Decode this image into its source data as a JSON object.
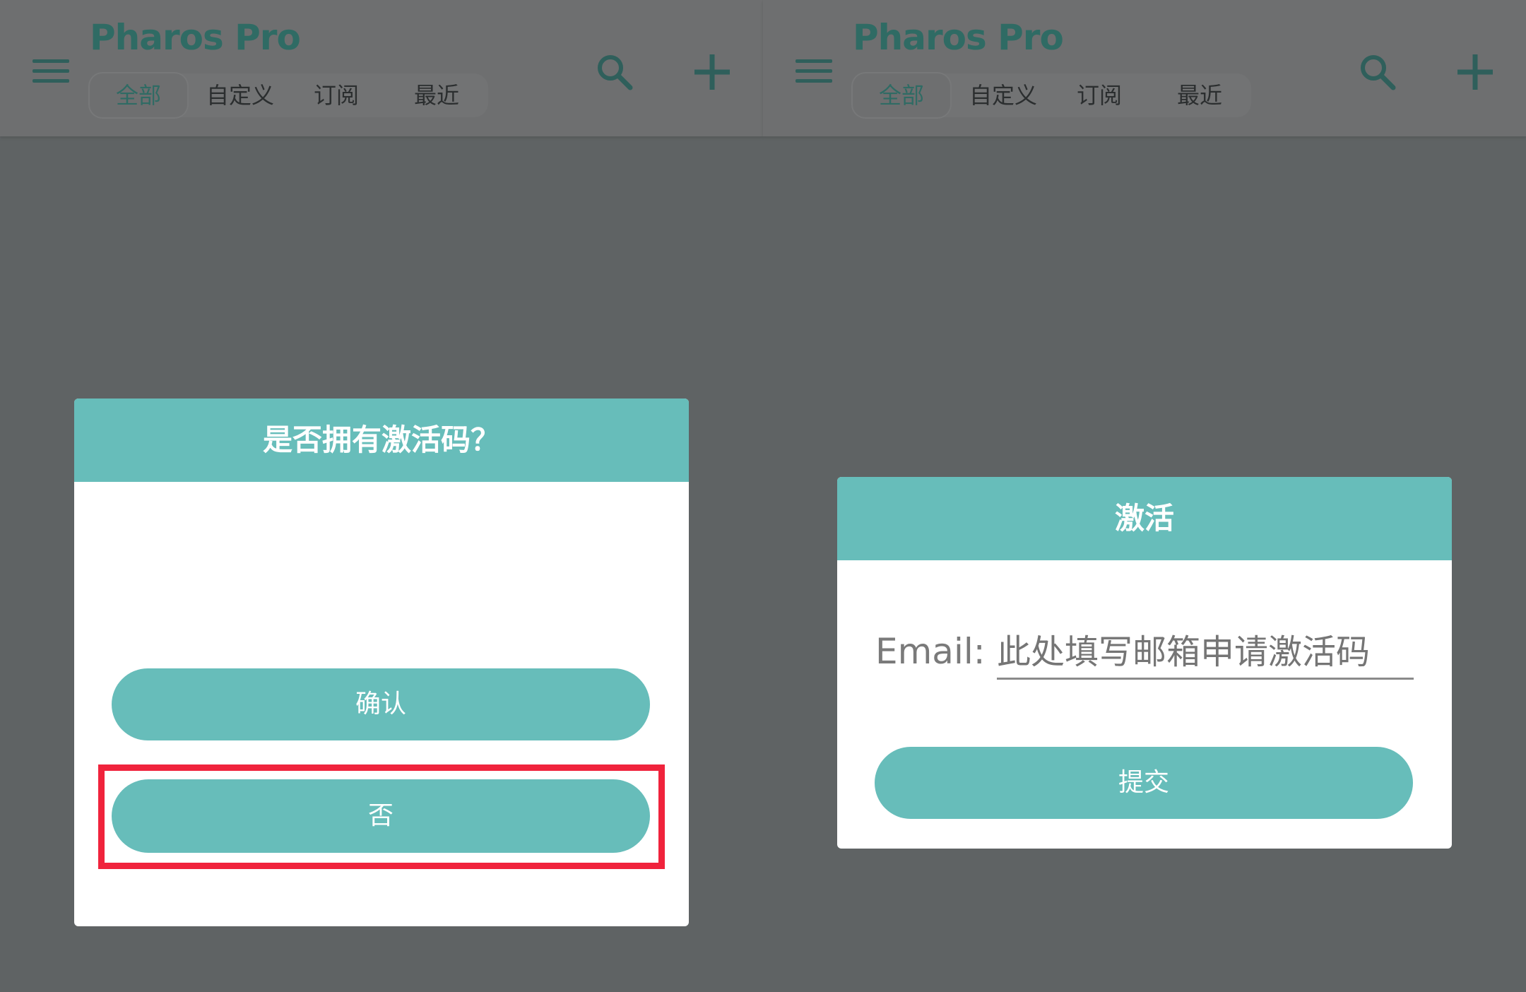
{
  "left_panel": {
    "appbar": {
      "title": "Pharos Pro",
      "tabs": [
        {
          "label": "全部",
          "active": true
        },
        {
          "label": "自定义",
          "active": false
        },
        {
          "label": "订阅",
          "active": false
        },
        {
          "label": "最近",
          "active": false
        }
      ],
      "icons": {
        "menu": "menu-icon",
        "search": "search-icon",
        "add": "plus-icon"
      }
    },
    "dialog": {
      "title": "是否拥有激活码？",
      "confirm_label": "确认",
      "no_label": "否"
    }
  },
  "right_panel": {
    "appbar": {
      "title": "Pharos Pro",
      "tabs": [
        {
          "label": "全部",
          "active": true
        },
        {
          "label": "自定义",
          "active": false
        },
        {
          "label": "订阅",
          "active": false
        },
        {
          "label": "最近",
          "active": false
        }
      ],
      "icons": {
        "menu": "menu-icon",
        "search": "search-icon",
        "add": "plus-icon"
      }
    },
    "dialog": {
      "title": "激活",
      "email_label": "Email:",
      "email_placeholder": "此处填写邮箱申请激活码",
      "email_value": "",
      "submit_label": "提交"
    }
  },
  "colors": {
    "accent": "#67bdba",
    "scrim_background": "#5f6364",
    "highlight": "#f0233c",
    "title_teal": "#2f6b64"
  }
}
